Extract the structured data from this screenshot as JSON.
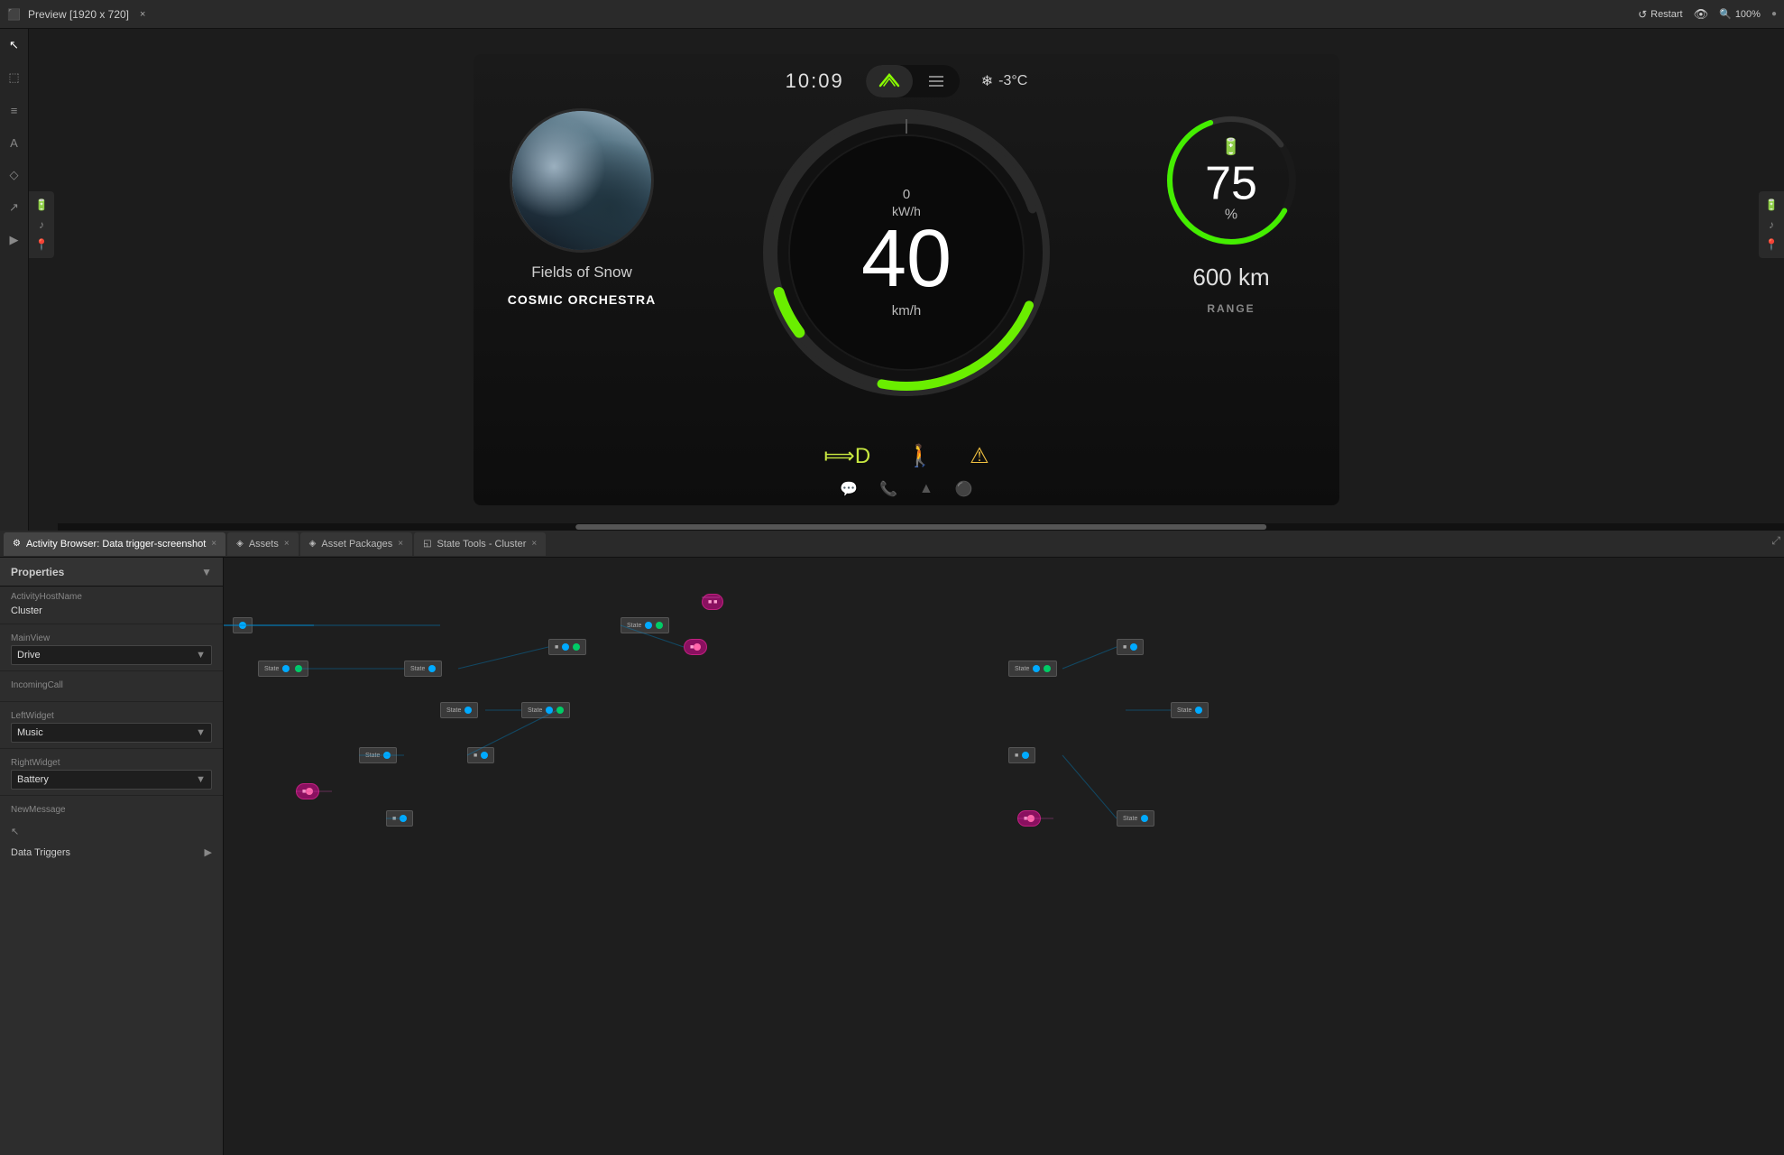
{
  "topbar": {
    "title": "Preview [1920 x 720]",
    "close_label": "×",
    "restart_label": "Restart",
    "zoom_label": "100%",
    "dot_label": "●"
  },
  "dashboard": {
    "time": "10:09",
    "weather": "❄ -3°C",
    "speed": "40",
    "speed_unit": "km/h",
    "power_label": "0",
    "power_unit": "kW/h",
    "track_name": "Fields of Snow",
    "artist_name": "COSMIC ORCHESTRA",
    "battery_pct": "75",
    "battery_pct_sign": "%",
    "range_val": "600 km",
    "range_label": "RANGE",
    "icon_lights": "╡D",
    "icon_person": "♟",
    "icon_warning": "⚠"
  },
  "tabs": [
    {
      "label": "Activity Browser: Data trigger-screenshot",
      "icon": "⚙",
      "active": true
    },
    {
      "label": "Assets",
      "icon": "◈",
      "active": false
    },
    {
      "label": "Asset Packages",
      "icon": "◈",
      "active": false
    },
    {
      "label": "State Tools - Cluster",
      "icon": "◱",
      "active": false
    }
  ],
  "properties": {
    "title": "Properties",
    "fields": [
      {
        "label": "ActivityHostName",
        "value": "Cluster",
        "type": "text"
      },
      {
        "label": "MainView",
        "value": "Drive",
        "type": "select"
      },
      {
        "label": "IncomingCall",
        "value": "",
        "type": "text"
      },
      {
        "label": "LeftWidget",
        "value": "Music",
        "type": "select"
      },
      {
        "label": "RightWidget",
        "value": "Battery",
        "type": "select"
      },
      {
        "label": "NewMessage",
        "value": "",
        "type": "text"
      }
    ],
    "data_triggers_label": "Data Triggers"
  },
  "sidebar_icons": [
    {
      "name": "cursor",
      "symbol": "↖",
      "active": true
    },
    {
      "name": "select",
      "symbol": "⬚"
    },
    {
      "name": "layers",
      "symbol": "≡"
    },
    {
      "name": "text",
      "symbol": "A"
    },
    {
      "name": "shapes",
      "symbol": "◇"
    },
    {
      "name": "share",
      "symbol": "↗"
    },
    {
      "name": "video",
      "symbol": "▶"
    }
  ]
}
